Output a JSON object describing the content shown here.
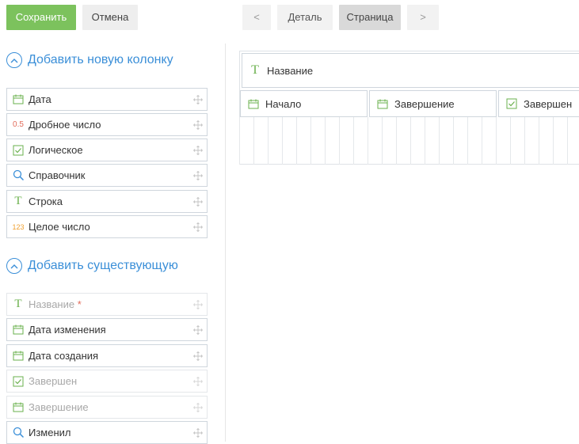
{
  "toolbar": {
    "save_label": "Сохранить",
    "cancel_label": "Отмена"
  },
  "nav": {
    "prev": "<",
    "detail": "Деталь",
    "page": "Страница",
    "next": ">"
  },
  "add_new": {
    "title": "Добавить новую колонку",
    "items": [
      {
        "label": "Дата",
        "icon": "calendar-icon"
      },
      {
        "label": "Дробное число",
        "icon": "decimal-icon",
        "icon_text": "0.5"
      },
      {
        "label": "Логическое",
        "icon": "checkbox-icon"
      },
      {
        "label": "Справочник",
        "icon": "search-icon"
      },
      {
        "label": "Строка",
        "icon": "text-icon",
        "icon_text": "T"
      },
      {
        "label": "Целое число",
        "icon": "integer-icon",
        "icon_text": "123"
      }
    ]
  },
  "add_existing": {
    "title": "Добавить существующую",
    "items": [
      {
        "label": "Название",
        "icon": "text-icon",
        "icon_text": "T",
        "required_mark": "*",
        "disabled": true
      },
      {
        "label": "Дата изменения",
        "icon": "calendar-icon",
        "disabled": false
      },
      {
        "label": "Дата создания",
        "icon": "calendar-icon",
        "disabled": false
      },
      {
        "label": "Завершен",
        "icon": "checkbox-icon",
        "disabled": true
      },
      {
        "label": "Завершение",
        "icon": "calendar-icon",
        "disabled": true
      },
      {
        "label": "Изменил",
        "icon": "search-icon",
        "disabled": false
      }
    ]
  },
  "canvas": {
    "title_field": {
      "label": "Название",
      "icon": "text-icon",
      "icon_text": "T"
    },
    "row": [
      {
        "label": "Начало",
        "icon": "calendar-icon"
      },
      {
        "label": "Завершение",
        "icon": "calendar-icon"
      },
      {
        "label": "Завершен",
        "icon": "checkbox-icon"
      }
    ]
  },
  "colors": {
    "accent": "#3b8fd8",
    "save": "#7cc25d",
    "green_icon": "#6ab04c",
    "orange_icon": "#f0a030",
    "red_icon": "#e26c5b"
  }
}
